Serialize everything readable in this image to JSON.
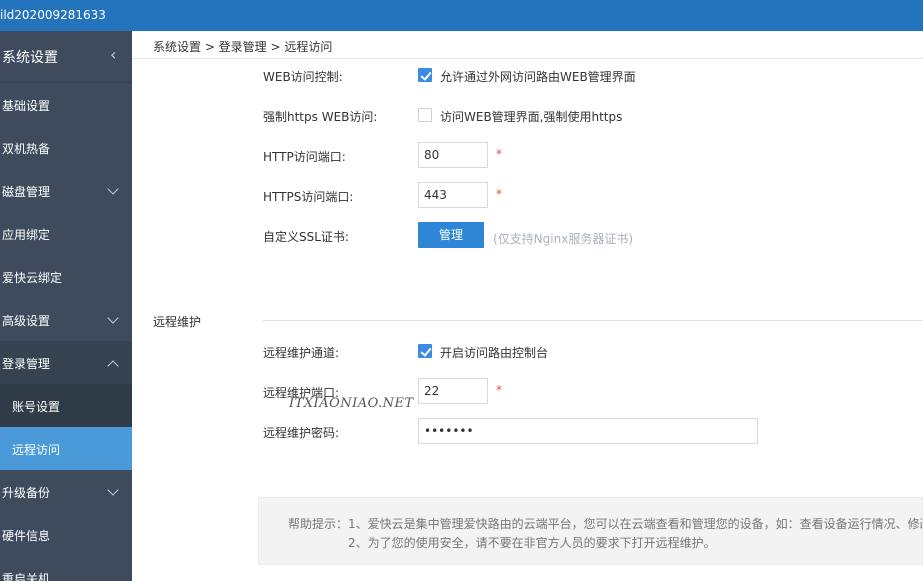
{
  "topbar": {
    "build": "ild202009281633"
  },
  "sidebar": {
    "title": "系统设置",
    "collapse_icon": "chevron-left-icon",
    "items": [
      {
        "label": "基础设置",
        "has_children": false
      },
      {
        "label": "双机热备",
        "has_children": false
      },
      {
        "label": "磁盘管理",
        "has_children": true
      },
      {
        "label": "应用绑定",
        "has_children": false
      },
      {
        "label": "爱快云绑定",
        "has_children": false
      },
      {
        "label": "高级设置",
        "has_children": true
      },
      {
        "label": "登录管理",
        "has_children": true,
        "expanded": true
      },
      {
        "label": "升级备份",
        "has_children": true
      },
      {
        "label": "硬件信息",
        "has_children": false
      },
      {
        "label": "重启关机",
        "has_children": false
      }
    ],
    "login_sub": [
      "账号设置",
      "远程访问"
    ],
    "active_sub": "远程访问"
  },
  "breadcrumb": "系统设置 > 登录管理 > 远程访问",
  "web": {
    "control_label": "WEB访问控制:",
    "control_checked": true,
    "control_text": "允许通过外网访问路由WEB管理界面",
    "https_label": "强制https WEB访问:",
    "https_checked": false,
    "https_text": "访问WEB管理界面,强制使用https",
    "http_port_label": "HTTP访问端口:",
    "http_port": "80",
    "https_port_label": "HTTPS访问端口:",
    "https_port": "443",
    "ssl_label": "自定义SSL证书:",
    "manage_button": "管理",
    "ssl_hint": "(仅支持Nginx服务器证书)",
    "required_mark": "*"
  },
  "remote": {
    "section_title": "远程维护",
    "channel_label": "远程维护通道:",
    "channel_checked": true,
    "channel_text": "开启访问路由控制台",
    "port_label": "远程维护端口:",
    "port": "22",
    "password_label": "远程维护密码:",
    "password": "1234567"
  },
  "watermark": "ITXIAONIAO.NET",
  "help": {
    "line1": "帮助提示：1、爱快云是集中管理爱快路由的云端平台，您可以在云端查看和管理您的设备，如：查看设备运行情况、修改",
    "line2": "2、为了您的使用安全，请不要在非官方人员的要求下打开远程维护。"
  },
  "colors": {
    "topbar": "#2474bd",
    "sidebar": "#3d4b5c",
    "active_item": "#4a9ad9",
    "button": "#2e87d6",
    "required": "#e74c3c"
  }
}
